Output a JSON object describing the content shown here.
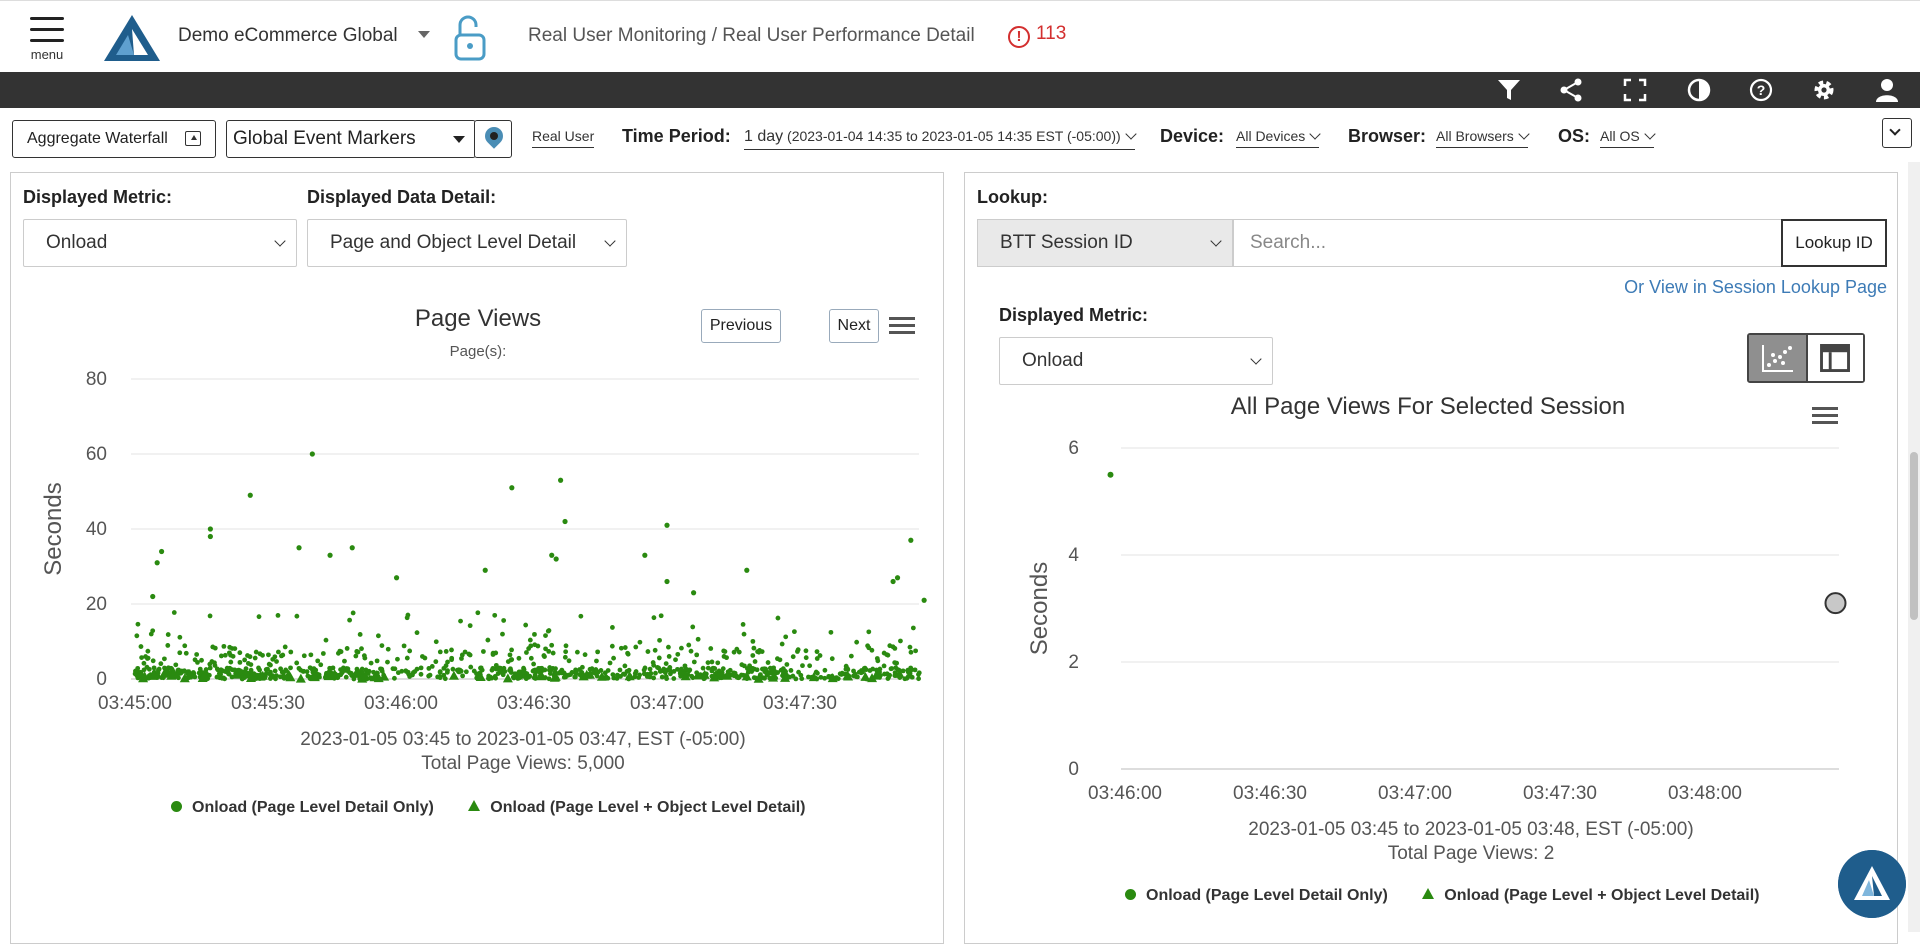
{
  "header": {
    "menu_label": "menu",
    "brand": "Demo eCommerce Global",
    "breadcrumb": "Real User Monitoring / Real User Performance Detail",
    "alert_count": "113"
  },
  "toolbar": {
    "icons": [
      "filter-icon",
      "share-icon",
      "fullscreen-icon",
      "contrast-icon",
      "help-icon",
      "settings-icon",
      "user-icon"
    ]
  },
  "filters": {
    "aggregate_waterfall": "Aggregate Waterfall",
    "event_markers": "Global Event Markers",
    "real_user": "Real User",
    "time_period_label": "Time Period:",
    "time_period_value": "1 day",
    "time_period_range": "(2023-01-04 14:35 to 2023-01-05 14:35 EST (-05:00))",
    "device_label": "Device:",
    "device_value": "All Devices",
    "browser_label": "Browser:",
    "browser_value": "All Browsers",
    "os_label": "OS:",
    "os_value": "All OS"
  },
  "left": {
    "metric_label": "Displayed Metric:",
    "metric_value": "Onload",
    "detail_label": "Displayed Data Detail:",
    "detail_value": "Page and Object Level Detail",
    "prev": "Previous",
    "next": "Next"
  },
  "right": {
    "lookup_label": "Lookup:",
    "lookup_type": "BTT Session ID",
    "search_placeholder": "Search...",
    "lookup_button": "Lookup ID",
    "session_link": "Or View in Session Lookup Page",
    "metric_label": "Displayed Metric:",
    "metric_value": "Onload"
  },
  "chart_data": [
    {
      "type": "scatter",
      "title": "Page Views",
      "subtitle": "Page(s):",
      "ylabel": "Seconds",
      "xlabel": "",
      "ylim": [
        0,
        80
      ],
      "yticks": [
        "0",
        "20",
        "40",
        "60",
        "80"
      ],
      "xticks": [
        "03:45:00",
        "03:45:30",
        "03:46:00",
        "03:46:30",
        "03:47:00",
        "03:47:30"
      ],
      "footer_range": "2023-01-05 03:45 to 2023-01-05 03:47, EST (-05:00)",
      "footer_total": "Total Page Views: 5,000",
      "grid": true,
      "series": [
        {
          "name": "Onload (Page Level Detail Only)",
          "marker": "circle",
          "color": "#2a8a10"
        },
        {
          "name": "Onload (Page Level + Object Level Detail)",
          "marker": "triangle",
          "color": "#2a8a10"
        }
      ],
      "notable_points": [
        {
          "x": "03:45:04",
          "y": 22
        },
        {
          "x": "03:45:05",
          "y": 31
        },
        {
          "x": "03:45:06",
          "y": 34
        },
        {
          "x": "03:45:17",
          "y": 38
        },
        {
          "x": "03:45:17",
          "y": 40
        },
        {
          "x": "03:45:26",
          "y": 49
        },
        {
          "x": "03:45:37",
          "y": 35
        },
        {
          "x": "03:45:40",
          "y": 60
        },
        {
          "x": "03:45:44",
          "y": 33
        },
        {
          "x": "03:45:49",
          "y": 35
        },
        {
          "x": "03:45:59",
          "y": 27
        },
        {
          "x": "03:46:19",
          "y": 29
        },
        {
          "x": "03:46:25",
          "y": 51
        },
        {
          "x": "03:46:34",
          "y": 33
        },
        {
          "x": "03:46:35",
          "y": 32
        },
        {
          "x": "03:46:36",
          "y": 53
        },
        {
          "x": "03:46:37",
          "y": 42
        },
        {
          "x": "03:46:55",
          "y": 33
        },
        {
          "x": "03:47:00",
          "y": 26
        },
        {
          "x": "03:47:00",
          "y": 41
        },
        {
          "x": "03:47:06",
          "y": 23
        },
        {
          "x": "03:47:18",
          "y": 29
        },
        {
          "x": "03:47:51",
          "y": 26
        },
        {
          "x": "03:47:52",
          "y": 27
        },
        {
          "x": "03:47:55",
          "y": 37
        },
        {
          "x": "03:47:58",
          "y": 21
        }
      ]
    },
    {
      "type": "scatter",
      "title": "All Page Views For Selected Session",
      "ylabel": "Seconds",
      "xlabel": "",
      "ylim": [
        0,
        6
      ],
      "yticks": [
        "0",
        "2",
        "4",
        "6"
      ],
      "xticks": [
        "03:46:00",
        "03:46:30",
        "03:47:00",
        "03:47:30",
        "03:48:00"
      ],
      "footer_range": "2023-01-05 03:45 to 2023-01-05 03:48, EST (-05:00)",
      "footer_total": "Total Page Views: 2",
      "grid": true,
      "series": [
        {
          "name": "Onload (Page Level Detail Only)",
          "marker": "circle",
          "color": "#2a8a10",
          "points": [
            {
              "x": "03:45:57",
              "y": 5.5
            }
          ]
        },
        {
          "name": "Onload (Page Level + Object Level Detail)",
          "marker": "triangle",
          "color": "#2a8a10",
          "points": []
        }
      ],
      "selected_point": {
        "x": "03:48:27",
        "y": 3.1,
        "color": "#c8c8c8"
      }
    }
  ]
}
